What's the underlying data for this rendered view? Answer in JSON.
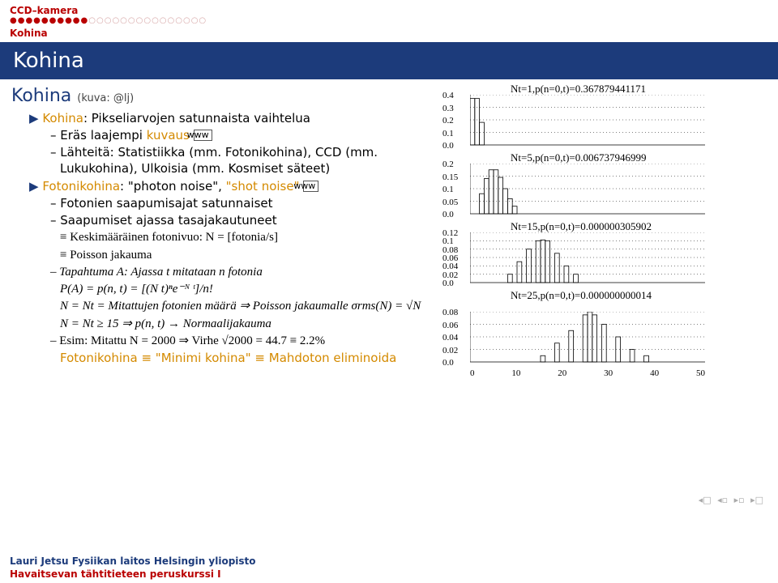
{
  "header": {
    "section": "CCD–kamera",
    "progress_filled": "●●●●●●●●●●",
    "progress_empty": "○○○○○○○○○○○○○○○",
    "subsection": "Kohina"
  },
  "titlebar": "Kohina",
  "subtitle": "Kohina",
  "subtitle_attr": "(kuva: @lj)",
  "bul1_a": "Kohina",
  "bul1_b": ": Pikseliarvojen satunnaista vaihtelua",
  "bul1_1a": "– Eräs laajempi",
  "bul1_1b": "kuvaus",
  "www": "www",
  "bul1_2a": "– Lähteitä: Statistiikka (mm. Fotonikohina), CCD (mm. Lukukohina), Ulkoisia (mm. Kosmiset säteet)",
  "bul2_a": "Fotonikohina",
  "bul2_b": ": \"photon noise\",",
  "bul2_c": "\"shot noise\"",
  "bul2_1": "– Fotonien saapumisajat satunnaiset",
  "bul2_2": "– Saapumiset ajassa tasajakautuneet",
  "bul2_3": "≡ Keskimääräinen fotonivuo: N = [fotonia/s]",
  "bul2_4": "≡ Poisson jakauma",
  "bul2_5": "– Tapahtuma A: Ajassa t mitataan n fotonia",
  "bul2_6": "P(A) = p(n, t) = [(N t)ⁿe⁻ᴺ ᵗ]/n!",
  "bul2_7": "N = Nt = Mitattujen fotonien määrä ⇒ Poisson jakaumalle σrms(N) = √N",
  "bul2_8": "N = Nt ≥ 15 ⇒ p(n, t) → Normaalijakauma",
  "bul2_9": "– Esim: Mitattu N = 2000 ⇒ Virhe √2000 = 44.7 ≡ 2.2%",
  "bul3": "Fotonikohina ≡ \"Minimi kohina\" ≡ Mahdoton eliminoida",
  "footer_author": "Lauri Jetsu",
  "footer_dept": "Fysiikan laitos",
  "footer_uni": "Helsingin yliopisto",
  "footer_course": "Havaitsevan tähtitieteen peruskurssi I",
  "chart_data": [
    {
      "type": "bar",
      "title": "Nt=1,p(n=0,t)=0.367879441171",
      "categories": [
        0,
        10,
        20,
        30,
        40,
        50
      ],
      "yticks": [
        0.0,
        0.1,
        0.2,
        0.3,
        0.4
      ],
      "bars": [
        {
          "x": 0,
          "y": 0.37
        },
        {
          "x": 1,
          "y": 0.37
        },
        {
          "x": 2,
          "y": 0.18
        }
      ]
    },
    {
      "type": "bar",
      "title": "Nt=5,p(n=0,t)=0.006737946999",
      "categories": [
        0,
        10,
        20,
        30,
        40,
        50
      ],
      "yticks": [
        0.0,
        0.05,
        0.1,
        0.15,
        0.2
      ],
      "bars": [
        {
          "x": 2,
          "y": 0.08
        },
        {
          "x": 3,
          "y": 0.14
        },
        {
          "x": 4,
          "y": 0.175
        },
        {
          "x": 5,
          "y": 0.175
        },
        {
          "x": 6,
          "y": 0.145
        },
        {
          "x": 7,
          "y": 0.1
        },
        {
          "x": 8,
          "y": 0.06
        },
        {
          "x": 9,
          "y": 0.03
        }
      ]
    },
    {
      "type": "bar",
      "title": "Nt=15,p(n=0,t)=0.000000305902",
      "categories": [
        0,
        10,
        20,
        30,
        40,
        50
      ],
      "yticks": [
        0.0,
        0.02,
        0.04,
        0.06,
        0.08,
        0.1,
        0.12
      ],
      "bars": [
        {
          "x": 8,
          "y": 0.02
        },
        {
          "x": 10,
          "y": 0.05
        },
        {
          "x": 12,
          "y": 0.08
        },
        {
          "x": 14,
          "y": 0.1
        },
        {
          "x": 15,
          "y": 0.102
        },
        {
          "x": 16,
          "y": 0.1
        },
        {
          "x": 18,
          "y": 0.07
        },
        {
          "x": 20,
          "y": 0.04
        },
        {
          "x": 22,
          "y": 0.02
        }
      ]
    },
    {
      "type": "bar",
      "title": "Nt=25,p(n=0,t)=0.000000000014",
      "categories": [
        0,
        10,
        20,
        30,
        40,
        50
      ],
      "yticks": [
        0.0,
        0.02,
        0.04,
        0.06,
        0.08
      ],
      "bars": [
        {
          "x": 15,
          "y": 0.01
        },
        {
          "x": 18,
          "y": 0.03
        },
        {
          "x": 21,
          "y": 0.05
        },
        {
          "x": 24,
          "y": 0.075
        },
        {
          "x": 25,
          "y": 0.08
        },
        {
          "x": 26,
          "y": 0.075
        },
        {
          "x": 28,
          "y": 0.06
        },
        {
          "x": 31,
          "y": 0.04
        },
        {
          "x": 34,
          "y": 0.02
        },
        {
          "x": 37,
          "y": 0.01
        }
      ]
    }
  ]
}
